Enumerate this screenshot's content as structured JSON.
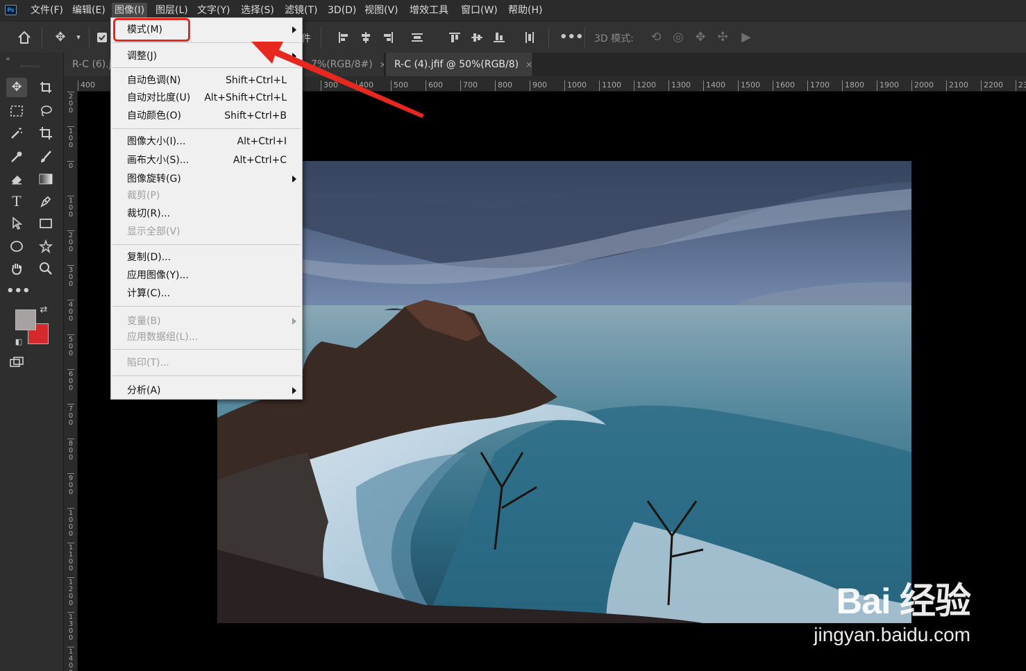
{
  "app": {
    "logo_text": "Ps"
  },
  "menubar": {
    "items": [
      {
        "label": "文件(F)"
      },
      {
        "label": "编辑(E)"
      },
      {
        "label": "图像(I)"
      },
      {
        "label": "图层(L)"
      },
      {
        "label": "文字(Y)"
      },
      {
        "label": "选择(S)"
      },
      {
        "label": "滤镜(T)"
      },
      {
        "label": "3D(D)"
      },
      {
        "label": "视图(V)"
      },
      {
        "label": "增效工具"
      },
      {
        "label": "窗口(W)"
      },
      {
        "label": "帮助(H)"
      }
    ],
    "active_item": "图像(I)"
  },
  "options_bar": {
    "mode_label": "3D 模式:",
    "partial_text": "件"
  },
  "tabs": [
    {
      "label": "R-C (6).j",
      "active": false
    },
    {
      "label": "7%(RGB/8#)",
      "active": false
    },
    {
      "label": "R-C (4).jfif @ 50%(RGB/8)",
      "active": true
    }
  ],
  "tab_close_glyph": "×",
  "ruler": {
    "horizontal": [
      "400",
      "300",
      "400",
      "500",
      "600",
      "700",
      "800",
      "900",
      "1000",
      "1100",
      "1200",
      "1300",
      "1400",
      "1500",
      "1600",
      "1700",
      "1800",
      "1900",
      "2000",
      "2100",
      "2200",
      "23"
    ],
    "vertical": [
      "200",
      "100",
      "0",
      "100",
      "200",
      "300",
      "400",
      "500",
      "600",
      "700",
      "800",
      "900",
      "1000",
      "1100",
      "1200",
      "1300",
      "1400"
    ]
  },
  "image_menu": {
    "items": [
      {
        "label": "模式(M)",
        "shortcut": "",
        "submenu": true,
        "disabled": false
      },
      {
        "label": "调整(J)",
        "shortcut": "",
        "submenu": true,
        "disabled": false
      },
      {
        "label": "自动色调(N)",
        "shortcut": "Shift+Ctrl+L",
        "submenu": false,
        "disabled": false
      },
      {
        "label": "自动对比度(U)",
        "shortcut": "Alt+Shift+Ctrl+L",
        "submenu": false,
        "disabled": false
      },
      {
        "label": "自动颜色(O)",
        "shortcut": "Shift+Ctrl+B",
        "submenu": false,
        "disabled": false
      },
      {
        "label": "图像大小(I)...",
        "shortcut": "Alt+Ctrl+I",
        "submenu": false,
        "disabled": false
      },
      {
        "label": "画布大小(S)...",
        "shortcut": "Alt+Ctrl+C",
        "submenu": false,
        "disabled": false
      },
      {
        "label": "图像旋转(G)",
        "shortcut": "",
        "submenu": true,
        "disabled": false
      },
      {
        "label": "裁剪(P)",
        "shortcut": "",
        "submenu": false,
        "disabled": true
      },
      {
        "label": "裁切(R)...",
        "shortcut": "",
        "submenu": false,
        "disabled": false
      },
      {
        "label": "显示全部(V)",
        "shortcut": "",
        "submenu": false,
        "disabled": true
      },
      {
        "label": "复制(D)...",
        "shortcut": "",
        "submenu": false,
        "disabled": false
      },
      {
        "label": "应用图像(Y)...",
        "shortcut": "",
        "submenu": false,
        "disabled": false
      },
      {
        "label": "计算(C)...",
        "shortcut": "",
        "submenu": false,
        "disabled": false
      },
      {
        "label": "变量(B)",
        "shortcut": "",
        "submenu": true,
        "disabled": true
      },
      {
        "label": "应用数据组(L)...",
        "shortcut": "",
        "submenu": false,
        "disabled": true
      },
      {
        "label": "陷印(T)...",
        "shortcut": "",
        "submenu": false,
        "disabled": true
      },
      {
        "label": "分析(A)",
        "shortcut": "",
        "submenu": true,
        "disabled": false
      }
    ]
  },
  "colors": {
    "foreground": "#a6a2a2",
    "background": "#d42a2e",
    "annotation_red": "#e8281e"
  },
  "watermark": {
    "brand": "Bai 经验",
    "url": "jingyan.baidu.com"
  }
}
